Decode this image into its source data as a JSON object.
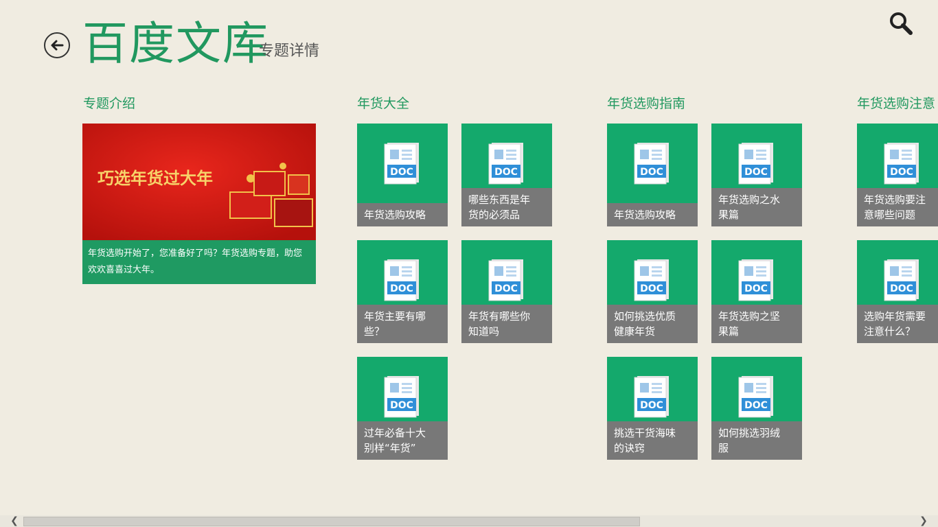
{
  "header": {
    "title": "百度文库",
    "subtitle": "专题详情"
  },
  "sections": [
    {
      "title": "专题介绍"
    },
    {
      "title": "年货大全"
    },
    {
      "title": "年货选购指南"
    },
    {
      "title": "年货选购注意"
    }
  ],
  "intro": {
    "banner_text": "巧选年货过大年",
    "description": "年货选购开始了，您准备好了吗？年货选购专题，助您欢欢喜喜过大年。"
  },
  "doc_badge": "DOC",
  "tiles": [
    {
      "line1": "年货选购攻略",
      "line2": ""
    },
    {
      "line1": "哪些东西是年",
      "line2": "货的必须品"
    },
    {
      "line1": "年货主要有哪",
      "line2": "些？"
    },
    {
      "line1": "年货有哪些你",
      "line2": "知道吗"
    },
    {
      "line1": "过年必备十大",
      "line2": "别样“年货”"
    },
    {
      "line1": "年货选购攻略",
      "line2": ""
    },
    {
      "line1": "年货选购之水",
      "line2": "果篇"
    },
    {
      "line1": "如何挑选优质",
      "line2": "健康年货"
    },
    {
      "line1": "年货选购之坚",
      "line2": "果篇"
    },
    {
      "line1": "挑选干货海味",
      "line2": "的诀窍"
    },
    {
      "line1": "如何挑选羽绒",
      "line2": "服"
    },
    {
      "line1": "年货选购要注",
      "line2": "意哪些问题"
    },
    {
      "line1": "选购年货需要",
      "line2": "注意什么？"
    }
  ],
  "colors": {
    "background": "#f0ece1",
    "brand_green": "#21985f",
    "tile_green": "#14a96c",
    "caption_gray": "#787878"
  },
  "icons": [
    "back-arrow-icon",
    "search-icon",
    "doc-file-icon",
    "scroll-left-icon",
    "scroll-right-icon"
  ]
}
